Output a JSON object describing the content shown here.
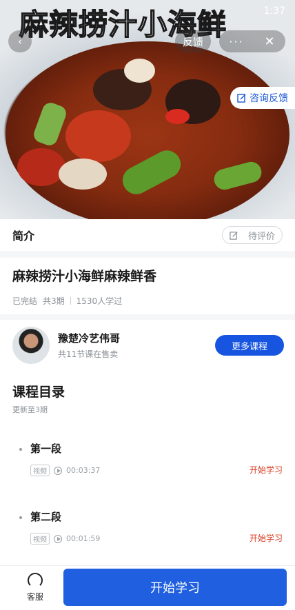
{
  "hero": {
    "title": "麻辣捞汁小海鲜",
    "status_time": "1:37",
    "feedback_label": "反馈",
    "more_label": "···",
    "close_label": "✕",
    "back_label": "‹",
    "consult_label": "咨询反馈"
  },
  "intro": {
    "label": "简介",
    "rate_label": "待评价"
  },
  "course": {
    "title": "麻辣捞汁小海鲜麻辣鲜香",
    "status": "已完结",
    "episodes": "共3期",
    "learners": "1530人学过"
  },
  "teacher": {
    "name": "豫楚冷艺伟哥",
    "sub": "共11节课在售卖",
    "more_courses": "更多课程"
  },
  "catalog": {
    "title": "课程目录",
    "sub": "更新至3期",
    "lessons": [
      {
        "name": "第一段",
        "tag": "视频",
        "duration": "00:03:37",
        "action": "开始学习"
      },
      {
        "name": "第二段",
        "tag": "视频",
        "duration": "00:01:59",
        "action": "开始学习"
      }
    ]
  },
  "bottom": {
    "service_label": "客服",
    "start_label": "开始学习"
  },
  "colors": {
    "primary_blue": "#1f5fe0",
    "start_link_red": "#d9381e"
  }
}
